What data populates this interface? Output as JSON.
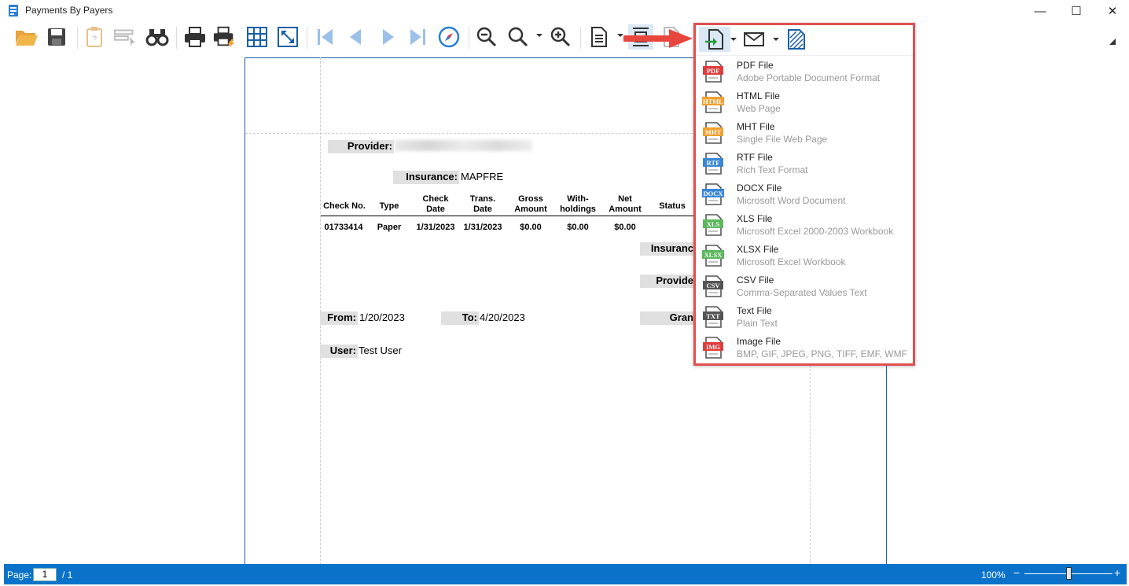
{
  "window": {
    "title": "Payments By Payers",
    "controls": {
      "minimize": "—",
      "maximize": "☐",
      "close": "✕"
    }
  },
  "colors": {
    "accent": "#0a73c9",
    "highlight_border": "#e05050",
    "page_border": "#1f5fa8"
  },
  "toolbar": {
    "icons": [
      "open-folder-icon",
      "save-icon",
      "parameters-icon",
      "select-area-icon",
      "find-icon",
      "print-icon",
      "quick-print-icon",
      "page-setup-icon",
      "scale-icon",
      "first-page-icon",
      "previous-page-icon",
      "next-page-icon",
      "last-page-icon",
      "navigation-icon",
      "zoom-out-icon",
      "zoom-icon",
      "zoom-in-icon",
      "page-layout-icon",
      "multipage-icon",
      "watermark-icon",
      "export-icon",
      "send-email-icon",
      "close-icon"
    ]
  },
  "report": {
    "provider_label": "Provider:",
    "insurance_label": "Insurance:",
    "insurance_value": "MAPFRE",
    "columns": [
      "Check No.",
      "Type",
      "Check\nDate",
      "Trans.\nDate",
      "Gross\nAmount",
      "With-\nholdings",
      "Net\nAmount",
      "Status"
    ],
    "rows": [
      [
        "01733414",
        "Paper",
        "1/31/2023",
        "1/31/2023",
        "$0.00",
        "$0.00",
        "$0.00",
        ""
      ]
    ],
    "insurance_total_label": "Insuranc",
    "provider_total_label": "Provide",
    "grand_total_label": "Gran",
    "from_label": "From:",
    "from_value": "1/20/2023",
    "to_label": "To:",
    "to_value": "4/20/2023",
    "user_label": "User:",
    "user_value": "Test User"
  },
  "export_menu": {
    "items": [
      {
        "badge": "PDF",
        "color": "#e03c3c",
        "name": "PDF File",
        "desc": "Adobe Portable Document Format"
      },
      {
        "badge": "HTML",
        "color": "#f0a030",
        "name": "HTML File",
        "desc": "Web Page"
      },
      {
        "badge": "MHT",
        "color": "#f0a030",
        "name": "MHT File",
        "desc": "Single File Web Page"
      },
      {
        "badge": "RTF",
        "color": "#3a86d6",
        "name": "RTF File",
        "desc": "Rich Text Format"
      },
      {
        "badge": "DOCX",
        "color": "#3a86d6",
        "name": "DOCX File",
        "desc": "Microsoft Word Document"
      },
      {
        "badge": "XLS",
        "color": "#5cb85c",
        "name": "XLS File",
        "desc": "Microsoft Excel 2000-2003 Workbook"
      },
      {
        "badge": "XLSX",
        "color": "#5cb85c",
        "name": "XLSX File",
        "desc": "Microsoft Excel Workbook"
      },
      {
        "badge": "CSV",
        "color": "#555555",
        "name": "CSV File",
        "desc": "Comma-Separated Values Text"
      },
      {
        "badge": "TXT",
        "color": "#555555",
        "name": "Text File",
        "desc": "Plain Text"
      },
      {
        "badge": "IMG",
        "color": "#e03c3c",
        "name": "Image File",
        "desc": "BMP, GIF, JPEG, PNG, TIFF, EMF, WMF"
      }
    ]
  },
  "statusbar": {
    "page_label": "Page:",
    "page_value": "1",
    "page_total": "/ 1",
    "zoom": "100%",
    "zoom_minus": "−",
    "zoom_plus": "+",
    "zoom_level_fraction": 0.5
  }
}
